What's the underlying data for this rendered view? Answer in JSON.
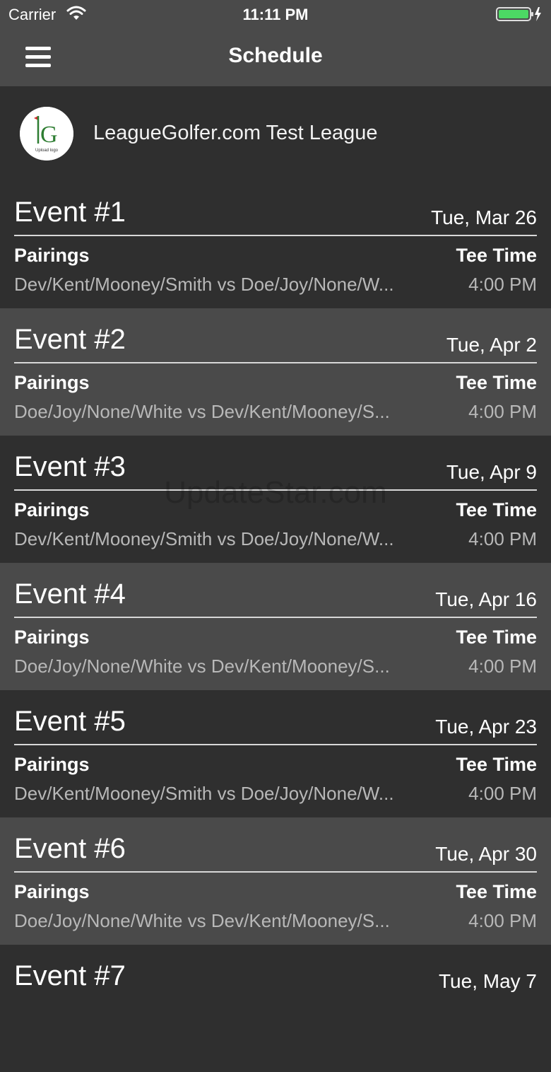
{
  "status": {
    "carrier": "Carrier",
    "time": "11:11 PM",
    "battery_color": "#4cd964"
  },
  "nav": {
    "title": "Schedule",
    "menu_icon": "hamburger-menu-icon"
  },
  "league": {
    "name": "LeagueGolfer.com Test League",
    "logo_letters": "lG",
    "logo_caption": "Upload logo"
  },
  "labels": {
    "pairings": "Pairings",
    "tee_time": "Tee Time"
  },
  "events": [
    {
      "title": "Event #1",
      "date": "Tue, Mar 26",
      "pairings": "Dev/Kent/Mooney/Smith vs Doe/Joy/None/W...",
      "tee_time": "4:00 PM"
    },
    {
      "title": "Event #2",
      "date": "Tue, Apr 2",
      "pairings": "Doe/Joy/None/White vs Dev/Kent/Mooney/S...",
      "tee_time": "4:00 PM"
    },
    {
      "title": "Event #3",
      "date": "Tue, Apr 9",
      "pairings": "Dev/Kent/Mooney/Smith vs Doe/Joy/None/W...",
      "tee_time": "4:00 PM"
    },
    {
      "title": "Event #4",
      "date": "Tue, Apr 16",
      "pairings": "Doe/Joy/None/White vs Dev/Kent/Mooney/S...",
      "tee_time": "4:00 PM"
    },
    {
      "title": "Event #5",
      "date": "Tue, Apr 23",
      "pairings": "Dev/Kent/Mooney/Smith vs Doe/Joy/None/W...",
      "tee_time": "4:00 PM"
    },
    {
      "title": "Event #6",
      "date": "Tue, Apr 30",
      "pairings": "Doe/Joy/None/White vs Dev/Kent/Mooney/S...",
      "tee_time": "4:00 PM"
    },
    {
      "title": "Event #7",
      "date": "Tue, May 7",
      "pairings": "",
      "tee_time": ""
    }
  ],
  "watermark": "UpdateStar.com",
  "colors": {
    "nav_bg": "#4a4a4a",
    "row_dark": "#2f2f2f",
    "row_light": "#4a4a4a",
    "secondary_text": "#b8b8b8"
  }
}
